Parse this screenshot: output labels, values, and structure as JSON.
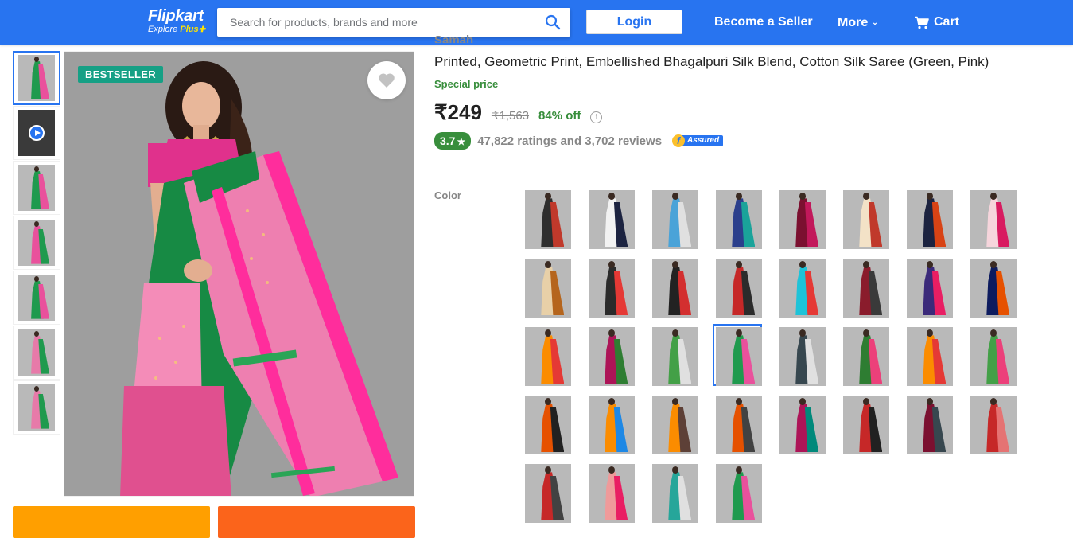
{
  "header": {
    "logo_text": "Flipkart",
    "logo_sub": "Explore",
    "logo_plus": "Plus",
    "search_placeholder": "Search for products, brands and more",
    "login_label": "Login",
    "seller_label": "Become a Seller",
    "more_label": "More",
    "cart_label": "Cart",
    "colors": {
      "brand": "#2874f0",
      "plus": "#ffe500"
    }
  },
  "gallery": {
    "badge": "BESTSELLER",
    "thumbnails": [
      {
        "kind": "image",
        "name": "thumb-1",
        "colors": [
          "#1f9a4e",
          "#e9519c"
        ]
      },
      {
        "kind": "video",
        "name": "thumb-video",
        "colors": [
          "#333333",
          "#555555"
        ]
      },
      {
        "kind": "image",
        "name": "thumb-3",
        "colors": [
          "#1f9a4e",
          "#e9519c"
        ]
      },
      {
        "kind": "image",
        "name": "thumb-4",
        "colors": [
          "#e9519c",
          "#1f9a4e"
        ]
      },
      {
        "kind": "image",
        "name": "thumb-5",
        "colors": [
          "#1f9a4e",
          "#e9519c"
        ]
      },
      {
        "kind": "image",
        "name": "thumb-6",
        "colors": [
          "#e77aa9",
          "#1f9a4e"
        ]
      },
      {
        "kind": "image",
        "name": "thumb-7",
        "colors": [
          "#e77aa9",
          "#1f9a4e"
        ]
      }
    ]
  },
  "product": {
    "brand": "Samah",
    "title": "Printed, Geometric Print, Embellished Bhagalpuri Silk Blend, Cotton Silk Saree  (Green, Pink)",
    "special_label": "Special price",
    "price": "₹249",
    "mrp": "₹1,563",
    "discount": "84% off",
    "rating": "3.7",
    "rating_star": "★",
    "ratings_text": "47,822 ratings and 3,702 reviews",
    "assured_f": "f",
    "assured_label": "Assured"
  },
  "color": {
    "label": "Color",
    "selected_index": 19,
    "swatches": [
      [
        "#2e2e2e",
        "#c0392b"
      ],
      [
        "#f2f2f2",
        "#1c2340"
      ],
      [
        "#4aa3d8",
        "#e0e0e0"
      ],
      [
        "#2b3f8c",
        "#1aa39a"
      ],
      [
        "#7b1030",
        "#c2185b"
      ],
      [
        "#f3e2c7",
        "#c0392b"
      ],
      [
        "#1c2340",
        "#d84315"
      ],
      [
        "#f6d5dc",
        "#d81b60"
      ],
      [
        "#e8d0a8",
        "#b5651d"
      ],
      [
        "#2b2b2b",
        "#e53935"
      ],
      [
        "#222222",
        "#d32f2f"
      ],
      [
        "#c62828",
        "#2b2b2b"
      ],
      [
        "#1ec3d8",
        "#e53935"
      ],
      [
        "#8a1c2c",
        "#3a3a3a"
      ],
      [
        "#3b2a7a",
        "#e91e63"
      ],
      [
        "#0d1b5e",
        "#e65100"
      ],
      [
        "#fb8c00",
        "#e53935"
      ],
      [
        "#ad1457",
        "#2e7d32"
      ],
      [
        "#43a047",
        "#e0e0e0"
      ],
      [
        "#1f9a4e",
        "#e9519c"
      ],
      [
        "#37474f",
        "#e0e0e0"
      ],
      [
        "#2e7d32",
        "#ec407a"
      ],
      [
        "#fb8c00",
        "#e53935"
      ],
      [
        "#43a047",
        "#ec407a"
      ],
      [
        "#e65100",
        "#212121"
      ],
      [
        "#fb8c00",
        "#1e88e5"
      ],
      [
        "#fb8c00",
        "#5d4037"
      ],
      [
        "#e65100",
        "#424242"
      ],
      [
        "#ad1457",
        "#00897b"
      ],
      [
        "#c62828",
        "#212121"
      ],
      [
        "#7b1030",
        "#37474f"
      ],
      [
        "#c62828",
        "#e57373"
      ],
      [
        "#c62828",
        "#424242"
      ],
      [
        "#ef9a9a",
        "#e91e63"
      ],
      [
        "#26a69a",
        "#e0e0e0"
      ],
      [
        "#1f9a4e",
        "#e9519c"
      ]
    ]
  }
}
